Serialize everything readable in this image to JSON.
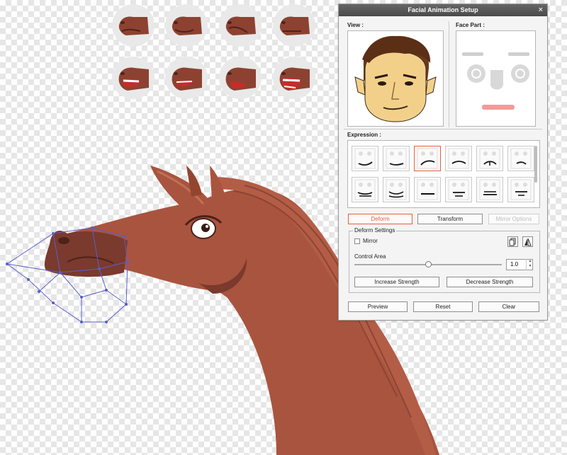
{
  "dialog": {
    "title": "Facial Animation Setup",
    "close": "×",
    "view_label": "View :",
    "face_part_label": "Face Part :",
    "expression_label": "Expression :",
    "tabs": {
      "deform": "Deform",
      "transform": "Transform",
      "mirror_options": "Mirror Options"
    },
    "deform_settings": {
      "title": "Deform Settings",
      "mirror_label": "Mirror",
      "mirror_checked": false,
      "control_area_label": "Control Area",
      "control_area_value": "1.0",
      "slider_fraction": 0.5,
      "increase": "Increase Strength",
      "decrease": "Decrease Strength"
    },
    "bottom_buttons": {
      "preview": "Preview",
      "reset": "Reset",
      "clear": "Clear"
    },
    "selected_expression": 2
  },
  "colors": {
    "horse": "#a9543f",
    "horse_dark": "#7a3a2d",
    "accent": "#e5603a",
    "mesh": "#5a5ec9",
    "mouth_red": "#c62d2a"
  }
}
